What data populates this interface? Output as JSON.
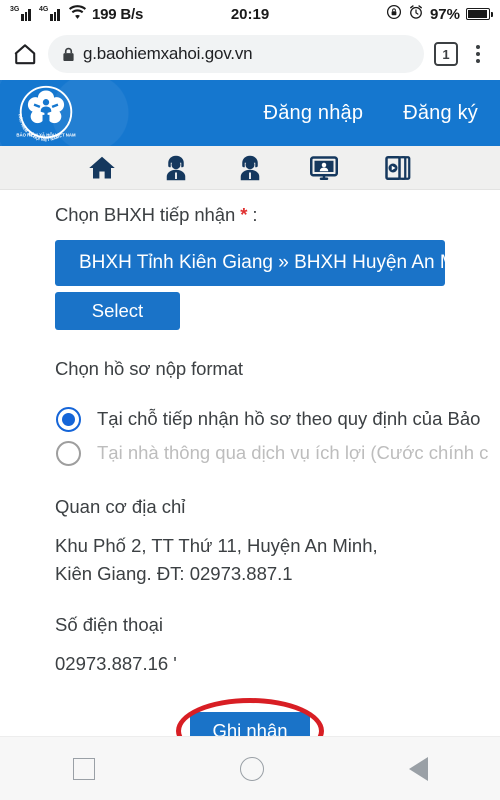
{
  "statusbar": {
    "network_3g_label": "3G",
    "network_4g_label": "4G",
    "wifi_icon": "wifi-icon",
    "net_speed": "199 B/s",
    "time": "20:19",
    "rotation_lock_icon": "rotation-lock-icon",
    "alarm_icon": "alarm-clock-icon",
    "battery_percent": "97%",
    "battery_icon": "battery-icon"
  },
  "browser": {
    "home_icon": "home-icon",
    "lock_icon": "lock-icon",
    "url": "g.baohiemxahoi.gov.vn",
    "tab_count": "1",
    "menu_icon": "overflow-menu-icon"
  },
  "site_header": {
    "logo_icon": "bhxh-vietnam-logo",
    "logo_text": "BẢO HIỂM XÃ HỘI VIỆT NAM",
    "login_label": "Đăng nhập",
    "register_label": "Đăng ký",
    "background_color": "#1577cf"
  },
  "icon_nav": {
    "items": [
      {
        "name": "home-icon",
        "label": "Trang chủ"
      },
      {
        "name": "support-agent-icon",
        "label": "Hỗ trợ"
      },
      {
        "name": "support-agent-icon",
        "label": "Tư vấn"
      },
      {
        "name": "monitor-person-icon",
        "label": "Trực tuyến"
      },
      {
        "name": "media-book-icon",
        "label": "Tài liệu"
      }
    ]
  },
  "form": {
    "agency_label": "Chọn BHXH tiếp nhận",
    "required_mark": "*",
    "label_colon": ":",
    "agency_value": "BHXH Tỉnh Kiên Giang » BHXH Huyện An M",
    "select_button": "Select",
    "format_label": "Chọn hồ sơ nộp format",
    "radio_options": [
      {
        "label": "Tại chỗ tiếp nhận hồ sơ theo quy định của Bảo",
        "selected": true,
        "disabled": false
      },
      {
        "label": "Tại nhà thông qua dịch vụ ích lợi (Cước chính c",
        "selected": false,
        "disabled": true
      }
    ],
    "address_label": "Quan cơ địa chỉ",
    "address_value": "Khu Phố 2, TT Thứ 11, Huyện An Minh, Kiên Giang. ĐT: 02973.887.1",
    "phone_label": "Số điện thoại",
    "phone_value": "02973.887.16 '",
    "submit_button": "Ghi nhận",
    "accent_color": "#1a73c8",
    "annotation_color": "#d81e24"
  },
  "android_nav": {
    "recents_icon": "recents-square-icon",
    "home_icon": "home-circle-icon",
    "back_icon": "back-triangle-icon"
  }
}
